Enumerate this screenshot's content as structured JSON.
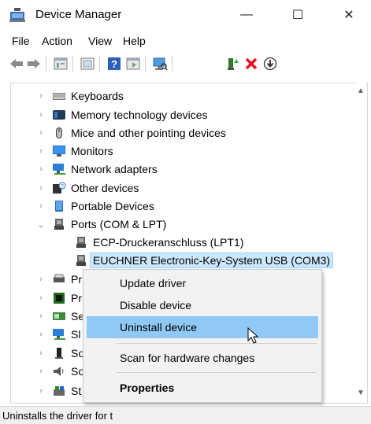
{
  "window": {
    "title": "Device Manager",
    "minimize": "—",
    "maximize": "☐",
    "close": "✕"
  },
  "menu": [
    "File",
    "Action",
    "View",
    "Help"
  ],
  "toolbar": {
    "icons": [
      "back-icon",
      "forward-icon",
      "properties-icon",
      "show-hidden-icon",
      "help-icon",
      "details-icon",
      "scan-icon",
      "update-driver-icon",
      "uninstall-icon",
      "disable-icon"
    ]
  },
  "tree": {
    "rows": [
      {
        "label": "Keyboards",
        "expanded": false,
        "child": false,
        "icon": "keyboard-icon"
      },
      {
        "label": "Memory technology devices",
        "expanded": false,
        "child": false,
        "icon": "memory-icon"
      },
      {
        "label": "Mice and other pointing devices",
        "expanded": false,
        "child": false,
        "icon": "mouse-icon"
      },
      {
        "label": "Monitors",
        "expanded": false,
        "child": false,
        "icon": "monitor-icon"
      },
      {
        "label": "Network adapters",
        "expanded": false,
        "child": false,
        "icon": "network-icon"
      },
      {
        "label": "Other devices",
        "expanded": false,
        "child": false,
        "icon": "other-devices-icon"
      },
      {
        "label": "Portable Devices",
        "expanded": false,
        "child": false,
        "icon": "portable-icon"
      },
      {
        "label": "Ports (COM & LPT)",
        "expanded": true,
        "child": false,
        "icon": "port-icon"
      },
      {
        "label": "ECP-Druckeranschluss (LPT1)",
        "expanded": false,
        "child": true,
        "icon": "port-icon"
      },
      {
        "label": "EUCHNER Electronic-Key-System USB (COM3)",
        "expanded": false,
        "child": true,
        "selected": true,
        "icon": "port-icon"
      },
      {
        "label": "Pr",
        "expanded": false,
        "child": false,
        "icon": "print-queue-icon"
      },
      {
        "label": "Pr",
        "expanded": false,
        "child": false,
        "icon": "processor-icon"
      },
      {
        "label": "Se",
        "expanded": false,
        "child": false,
        "icon": "security-icon"
      },
      {
        "label": "Sl",
        "expanded": false,
        "child": false,
        "icon": "software-icon"
      },
      {
        "label": "So",
        "expanded": false,
        "child": false,
        "icon": "software-device-icon"
      },
      {
        "label": "So",
        "expanded": false,
        "child": false,
        "icon": "sound-icon"
      },
      {
        "label": "St",
        "expanded": false,
        "child": false,
        "icon": "storage-icon"
      }
    ]
  },
  "context_menu": {
    "update": "Update driver",
    "disable": "Disable device",
    "uninstall": "Uninstall device",
    "scan": "Scan for hardware changes",
    "properties": "Properties"
  },
  "status": {
    "text": "Uninstalls the driver for t"
  },
  "colors": {
    "hover": "#90c8f6",
    "selected_bg": "#cce8ff",
    "uninstall_red": "#e81123"
  }
}
